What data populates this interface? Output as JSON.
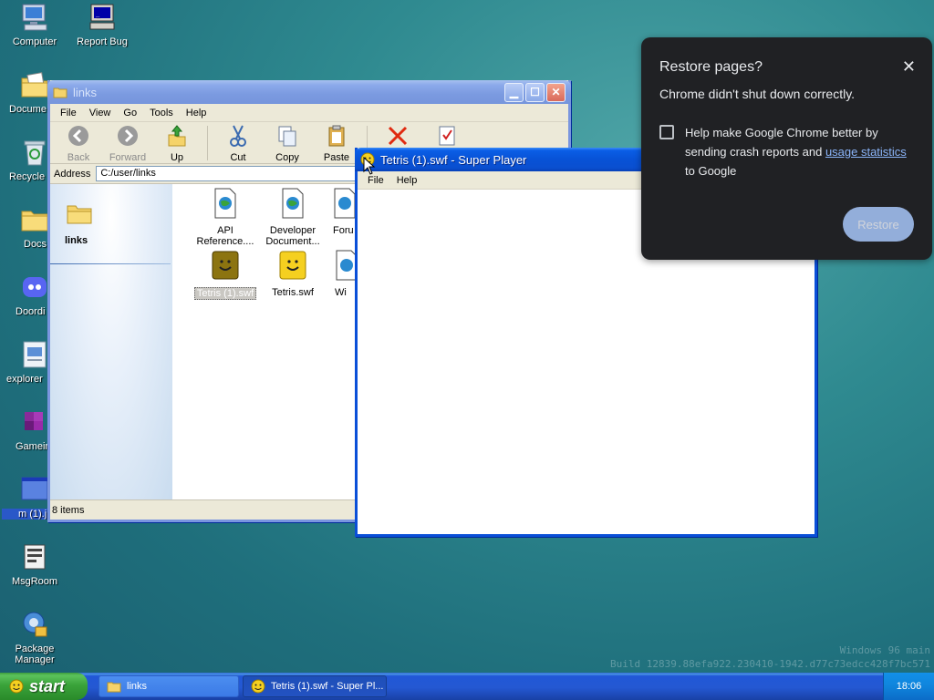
{
  "desktop": {
    "icons": [
      {
        "label": "Computer",
        "icon": "computer-icon"
      },
      {
        "label": "Report Bug",
        "icon": "report-bug-icon"
      },
      {
        "label": "Docume",
        "icon": "documents-folder-icon"
      },
      {
        "label": "Recycle",
        "icon": "recycle-bin-icon"
      },
      {
        "label": "Docs",
        "icon": "folder-icon"
      },
      {
        "label": "Doordi",
        "icon": "discord-icon"
      },
      {
        "label": "explorer",
        "icon": "explorer-app-icon"
      },
      {
        "label": "Gamein",
        "icon": "game-icon"
      },
      {
        "label": "m (1).j",
        "icon": "window-file-icon"
      },
      {
        "label": "MsgRoom",
        "icon": "msgroom-icon"
      },
      {
        "label": "Package Manager",
        "icon": "package-manager-icon"
      }
    ],
    "watermark_line1": "Windows 96 main",
    "watermark_line2": "Build 12839.88efa922.230410-1942.d77c73edcc428f7bc571"
  },
  "explorer": {
    "title": "links",
    "menu": [
      "File",
      "View",
      "Go",
      "Tools",
      "Help"
    ],
    "toolbar": {
      "back": "Back",
      "forward": "Forward",
      "up": "Up",
      "cut": "Cut",
      "copy": "Copy",
      "paste": "Paste"
    },
    "address_label": "Address",
    "address_value": "C:/user/links",
    "side_title": "links",
    "files": [
      {
        "label": "API Reference....",
        "icon": "web-document-icon"
      },
      {
        "label": "Developer Document...",
        "icon": "web-document-icon"
      },
      {
        "label": "Foru",
        "icon": "web-document-icon"
      },
      {
        "label": "Tetris (1).swf",
        "icon": "swf-smiley-icon",
        "selected": true
      },
      {
        "label": "Tetris.swf",
        "icon": "swf-smiley-icon"
      },
      {
        "label": "Wi",
        "icon": "web-document-icon"
      }
    ],
    "status": "8 items"
  },
  "player": {
    "title": "Tetris (1).swf - Super Player",
    "menu": [
      "File",
      "Help"
    ]
  },
  "chrome_dialog": {
    "title": "Restore pages?",
    "close": "✕",
    "message": "Chrome didn't shut down correctly.",
    "help_text": "Help make Google Chrome better by sending crash reports and",
    "help_link": "usage statistics",
    "help_suffix": "to Google",
    "restore_button": "Restore"
  },
  "taskbar": {
    "start_label": "start",
    "tasks": [
      {
        "label": "links",
        "icon": "folder-icon",
        "active": false
      },
      {
        "label": "Tetris (1).swf - Super Pl...",
        "icon": "smiley-icon",
        "active": true
      }
    ],
    "clock": "18:06"
  },
  "colors": {
    "xp_blue": "#0a4fd8",
    "start_green": "#3aa33a",
    "chrome_bg": "#202124",
    "chrome_link": "#8ab4f8",
    "chrome_button": "#a8c7fa"
  }
}
